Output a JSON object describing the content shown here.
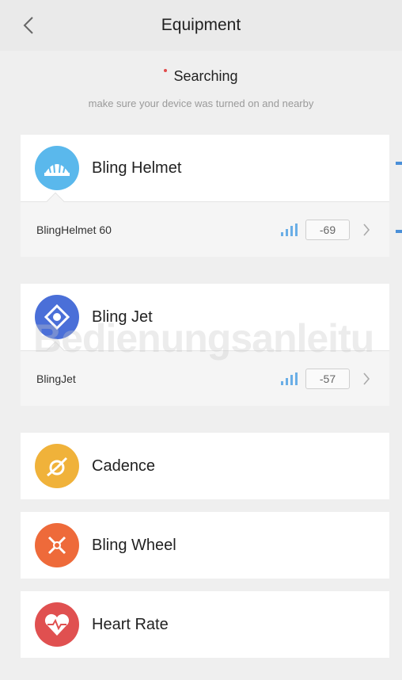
{
  "header": {
    "title": "Equipment"
  },
  "search": {
    "label": "Searching",
    "hint": "make sure your device was turned on and nearby"
  },
  "devices": [
    {
      "name": "Bling Helmet",
      "icon": "helmet-icon",
      "color": "#5ab8ec",
      "found": {
        "name": "BlingHelmet 60",
        "rssi": "-69"
      }
    },
    {
      "name": "Bling Jet",
      "icon": "drone-icon",
      "color": "#4a6fd8",
      "found": {
        "name": "BlingJet",
        "rssi": "-57"
      }
    },
    {
      "name": "Cadence",
      "icon": "cadence-icon",
      "color": "#f0b23a"
    },
    {
      "name": "Bling Wheel",
      "icon": "wheel-icon",
      "color": "#ee6a3a"
    },
    {
      "name": "Heart Rate",
      "icon": "heart-icon",
      "color": "#e05050"
    }
  ],
  "watermark": "Bedienungsanleitu",
  "colors": {
    "accent": "#4a8fd8",
    "signal": "#6aaee6"
  }
}
